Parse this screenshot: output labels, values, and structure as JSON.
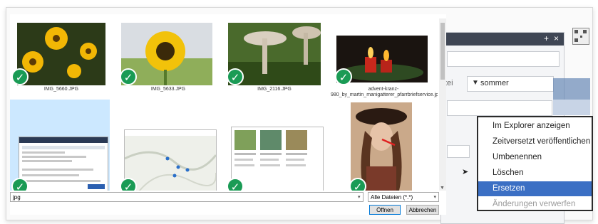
{
  "file_dialog": {
    "thumbnails": [
      {
        "caption": "IMG_5660.JPG",
        "checked": true
      },
      {
        "caption": "IMG_5633.JPG",
        "checked": true
      },
      {
        "caption": "IMG_2116.JPG",
        "checked": true
      },
      {
        "caption": "advent-kranz-980_by_martin_manigatterer_pfarrbriefservice.jpg",
        "checked": true
      },
      {
        "caption": "",
        "checked": true,
        "selected": true
      },
      {
        "caption": "",
        "checked": true
      },
      {
        "caption": "",
        "checked": true
      },
      {
        "caption": "",
        "checked": true
      }
    ],
    "filename_value": "jpg",
    "filetype_value": "Alle Dateien (*.*)",
    "open_label": "Öffnen",
    "cancel_label": "Abbrechen"
  },
  "cms": {
    "partial_label": "tei",
    "search_value": "sommer",
    "icons": [
      "plus-icon",
      "close-icon",
      "filter-icon",
      "qr-code-icon"
    ],
    "plus_glyph": "+",
    "close_glyph": "×"
  },
  "context_menu": {
    "items": [
      {
        "label": "Im Explorer anzeigen",
        "state": "normal"
      },
      {
        "label": "Zeitversetzt veröffentlichen",
        "state": "normal"
      },
      {
        "label": "Umbenennen",
        "state": "normal"
      },
      {
        "label": "Löschen",
        "state": "normal"
      },
      {
        "label": "Ersetzen",
        "state": "active"
      },
      {
        "label": "Änderungen verwerfen",
        "state": "disabled"
      }
    ]
  },
  "colors": {
    "check_green": "#1a9b55",
    "menu_highlight": "#3b6fc4",
    "selection_blue": "#cce8ff"
  }
}
